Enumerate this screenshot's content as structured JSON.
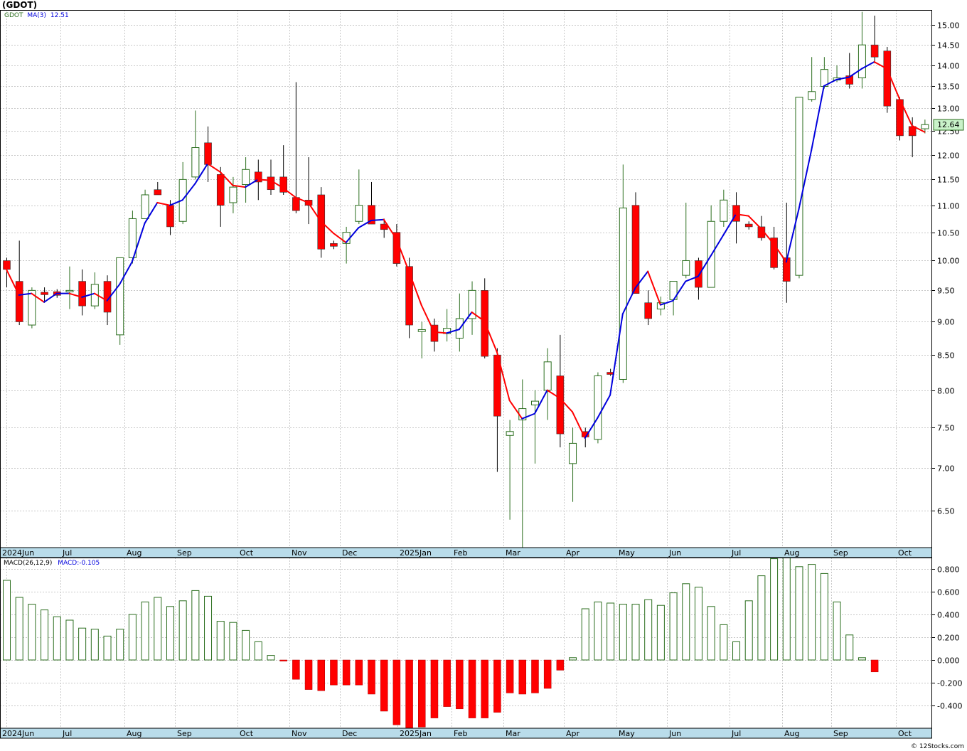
{
  "ticker_title": "(GDOT)",
  "price_legend": {
    "symbol": "GDOT",
    "ma_label": "MA(3)",
    "ma_value": "12.51"
  },
  "macd_legend": {
    "label": "MACD(26,12,9)",
    "value_text": "MACD:-0.105"
  },
  "last_price_label": "12.64",
  "credit": "© 12Stocks.com",
  "colors": {
    "up_candle_border": "#2b6e1e",
    "down_candle": "#ff0000",
    "ma_rising": "#0000dd",
    "ma_falling": "#ff0000",
    "macd_positive": "#2b6e1e",
    "macd_negative": "#ff0000",
    "axis_band": "#b9dcea",
    "grid": "#c8c8c8",
    "last_price_box": "#c9f2c9"
  },
  "x_axis_labels": [
    "2024Jun",
    "Jul",
    "Aug",
    "Sep",
    "Oct",
    "Nov",
    "Dec",
    "2025Jan",
    "Feb",
    "Mar",
    "Apr",
    "May",
    "Jun",
    "Jul",
    "Aug",
    "Sep",
    "Oct"
  ],
  "chart_data": [
    {
      "type": "candlestick",
      "title": "(GDOT)",
      "scale": "log",
      "ylim": [
        6.1,
        15.4
      ],
      "y_ticks": [
        "15.00",
        "14.50",
        "14.00",
        "13.50",
        "13.00",
        "12.50",
        "12.00",
        "11.50",
        "11.00",
        "10.50",
        "10.00",
        "9.50",
        "9.00",
        "8.50",
        "8.00",
        "7.50",
        "7.00",
        "6.50"
      ],
      "series_name": "GDOT",
      "ma_name": "MA(3)",
      "candles": [
        {
          "o": 10.0,
          "h": 10.05,
          "l": 9.55,
          "c": 9.85
        },
        {
          "o": 9.65,
          "h": 10.35,
          "l": 8.95,
          "c": 9.0
        },
        {
          "o": 8.95,
          "h": 9.55,
          "l": 8.9,
          "c": 9.5
        },
        {
          "o": 9.47,
          "h": 9.55,
          "l": 9.3,
          "c": 9.43
        },
        {
          "o": 9.48,
          "h": 9.52,
          "l": 9.38,
          "c": 9.42
        },
        {
          "o": 9.5,
          "h": 9.9,
          "l": 9.2,
          "c": 9.5
        },
        {
          "o": 9.65,
          "h": 9.85,
          "l": 9.1,
          "c": 9.25
        },
        {
          "o": 9.25,
          "h": 9.8,
          "l": 9.2,
          "c": 9.6
        },
        {
          "o": 9.65,
          "h": 9.75,
          "l": 8.95,
          "c": 9.15
        },
        {
          "o": 8.8,
          "h": 10.05,
          "l": 8.65,
          "c": 10.05
        },
        {
          "o": 10.05,
          "h": 10.9,
          "l": 9.95,
          "c": 10.75
        },
        {
          "o": 10.75,
          "h": 11.3,
          "l": 10.75,
          "c": 11.2
        },
        {
          "o": 11.3,
          "h": 11.45,
          "l": 11.2,
          "c": 11.2
        },
        {
          "o": 11.0,
          "h": 11.1,
          "l": 10.45,
          "c": 10.6
        },
        {
          "o": 10.7,
          "h": 11.85,
          "l": 10.65,
          "c": 11.5
        },
        {
          "o": 11.55,
          "h": 12.95,
          "l": 11.5,
          "c": 12.15
        },
        {
          "o": 12.25,
          "h": 12.6,
          "l": 11.45,
          "c": 11.8
        },
        {
          "o": 11.6,
          "h": 11.75,
          "l": 10.6,
          "c": 11.0
        },
        {
          "o": 11.05,
          "h": 11.55,
          "l": 10.85,
          "c": 11.35
        },
        {
          "o": 11.4,
          "h": 11.95,
          "l": 11.05,
          "c": 11.7
        },
        {
          "o": 11.65,
          "h": 11.9,
          "l": 11.1,
          "c": 11.45
        },
        {
          "o": 11.55,
          "h": 11.9,
          "l": 11.2,
          "c": 11.3
        },
        {
          "o": 11.55,
          "h": 12.2,
          "l": 11.2,
          "c": 11.25
        },
        {
          "o": 11.15,
          "h": 13.6,
          "l": 10.85,
          "c": 10.9
        },
        {
          "o": 11.1,
          "h": 11.95,
          "l": 10.65,
          "c": 11.0
        },
        {
          "o": 11.2,
          "h": 11.35,
          "l": 10.05,
          "c": 10.2
        },
        {
          "o": 10.3,
          "h": 10.35,
          "l": 10.2,
          "c": 10.25
        },
        {
          "o": 10.3,
          "h": 10.6,
          "l": 9.95,
          "c": 10.5
        },
        {
          "o": 10.7,
          "h": 11.7,
          "l": 10.65,
          "c": 11.0
        },
        {
          "o": 11.0,
          "h": 11.45,
          "l": 10.65,
          "c": 10.65
        },
        {
          "o": 10.65,
          "h": 10.75,
          "l": 10.4,
          "c": 10.55
        },
        {
          "o": 10.5,
          "h": 10.65,
          "l": 9.9,
          "c": 9.95
        },
        {
          "o": 9.9,
          "h": 10.05,
          "l": 8.75,
          "c": 8.95
        },
        {
          "o": 8.85,
          "h": 9.0,
          "l": 8.45,
          "c": 8.88
        },
        {
          "o": 8.95,
          "h": 9.05,
          "l": 8.55,
          "c": 8.7
        },
        {
          "o": 8.82,
          "h": 9.2,
          "l": 8.7,
          "c": 8.9
        },
        {
          "o": 8.75,
          "h": 9.45,
          "l": 8.55,
          "c": 9.05
        },
        {
          "o": 9.05,
          "h": 9.65,
          "l": 8.8,
          "c": 9.5
        },
        {
          "o": 9.5,
          "h": 9.7,
          "l": 8.45,
          "c": 8.48
        },
        {
          "o": 8.5,
          "h": 8.6,
          "l": 6.95,
          "c": 7.65
        },
        {
          "o": 7.4,
          "h": 7.6,
          "l": 6.4,
          "c": 7.45
        },
        {
          "o": 7.6,
          "h": 8.15,
          "l": 6.0,
          "c": 7.75
        },
        {
          "o": 7.8,
          "h": 8.0,
          "l": 7.05,
          "c": 7.85
        },
        {
          "o": 8.0,
          "h": 8.6,
          "l": 7.6,
          "c": 8.4
        },
        {
          "o": 8.2,
          "h": 8.8,
          "l": 7.25,
          "c": 7.42
        },
        {
          "o": 7.05,
          "h": 7.5,
          "l": 6.6,
          "c": 7.3
        },
        {
          "o": 7.45,
          "h": 7.5,
          "l": 7.25,
          "c": 7.38
        },
        {
          "o": 7.35,
          "h": 8.25,
          "l": 7.3,
          "c": 8.2
        },
        {
          "o": 8.25,
          "h": 8.3,
          "l": 8.2,
          "c": 8.22
        },
        {
          "o": 8.15,
          "h": 11.8,
          "l": 8.1,
          "c": 10.95
        },
        {
          "o": 11.0,
          "h": 11.25,
          "l": 9.45,
          "c": 9.45
        },
        {
          "o": 9.3,
          "h": 9.5,
          "l": 8.95,
          "c": 9.05
        },
        {
          "o": 9.2,
          "h": 9.4,
          "l": 9.1,
          "c": 9.3
        },
        {
          "o": 9.35,
          "h": 9.6,
          "l": 9.1,
          "c": 9.65
        },
        {
          "o": 9.75,
          "h": 11.05,
          "l": 9.7,
          "c": 10.0
        },
        {
          "o": 10.0,
          "h": 10.05,
          "l": 9.35,
          "c": 9.55
        },
        {
          "o": 9.55,
          "h": 11.0,
          "l": 9.55,
          "c": 10.7
        },
        {
          "o": 10.7,
          "h": 11.3,
          "l": 10.6,
          "c": 11.1
        },
        {
          "o": 11.0,
          "h": 11.25,
          "l": 10.3,
          "c": 10.7
        },
        {
          "o": 10.65,
          "h": 10.7,
          "l": 10.55,
          "c": 10.6
        },
        {
          "o": 10.6,
          "h": 10.8,
          "l": 10.35,
          "c": 10.4
        },
        {
          "o": 10.4,
          "h": 10.6,
          "l": 9.85,
          "c": 9.88
        },
        {
          "o": 10.05,
          "h": 11.05,
          "l": 9.3,
          "c": 9.65
        },
        {
          "o": 9.75,
          "h": 11.65,
          "l": 9.7,
          "c": 13.25
        },
        {
          "o": 13.2,
          "h": 14.2,
          "l": 13.15,
          "c": 13.38
        },
        {
          "o": 13.5,
          "h": 14.2,
          "l": 13.45,
          "c": 13.9
        },
        {
          "o": 13.65,
          "h": 14.0,
          "l": 13.6,
          "c": 13.7
        },
        {
          "o": 13.75,
          "h": 14.3,
          "l": 13.45,
          "c": 13.55
        },
        {
          "o": 13.7,
          "h": 15.35,
          "l": 13.45,
          "c": 14.5
        },
        {
          "o": 14.5,
          "h": 15.25,
          "l": 14.05,
          "c": 14.2
        },
        {
          "o": 14.35,
          "h": 14.45,
          "l": 12.9,
          "c": 13.05
        },
        {
          "o": 13.2,
          "h": 13.25,
          "l": 12.3,
          "c": 12.4
        },
        {
          "o": 12.6,
          "h": 12.8,
          "l": 11.95,
          "c": 12.4
        },
        {
          "o": 12.55,
          "h": 12.75,
          "l": 12.45,
          "c": 12.64
        }
      ]
    },
    {
      "type": "bar",
      "title": "MACD(26,12,9)",
      "ylim": [
        -0.6,
        0.9
      ],
      "y_ticks": [
        "0.800",
        "0.600",
        "0.400",
        "0.200",
        "0.000",
        "-0.200",
        "-0.400"
      ],
      "values": [
        0.7,
        0.55,
        0.49,
        0.44,
        0.38,
        0.35,
        0.28,
        0.27,
        0.21,
        0.27,
        0.4,
        0.51,
        0.55,
        0.47,
        0.52,
        0.61,
        0.56,
        0.34,
        0.33,
        0.26,
        0.16,
        0.04,
        -0.01,
        -0.17,
        -0.26,
        -0.27,
        -0.22,
        -0.22,
        -0.22,
        -0.3,
        -0.45,
        -0.57,
        -0.61,
        -0.59,
        -0.51,
        -0.41,
        -0.43,
        -0.51,
        -0.51,
        -0.46,
        -0.29,
        -0.3,
        -0.29,
        -0.25,
        -0.09,
        0.02,
        0.45,
        0.51,
        0.5,
        0.49,
        0.49,
        0.53,
        0.48,
        0.59,
        0.67,
        0.64,
        0.47,
        0.31,
        0.16,
        0.52,
        0.74,
        0.89,
        0.9,
        0.82,
        0.84,
        0.76,
        0.51,
        0.22,
        0.02,
        -0.105
      ]
    }
  ]
}
